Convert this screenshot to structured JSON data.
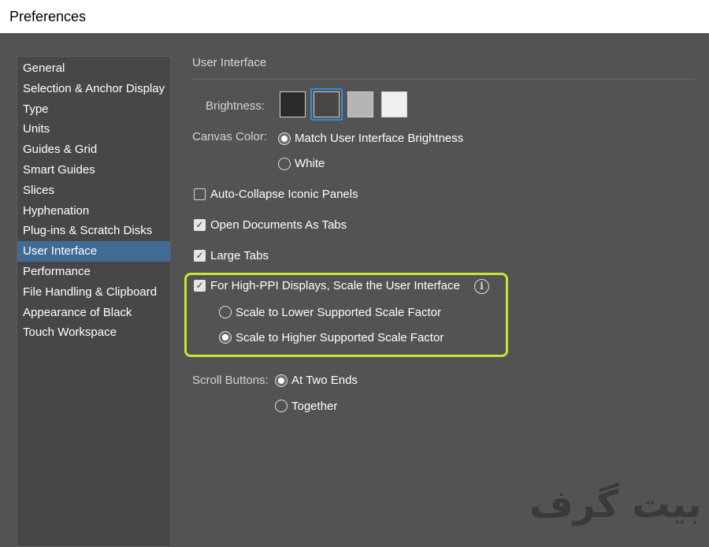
{
  "window": {
    "title": "Preferences"
  },
  "sidebar": {
    "items": [
      {
        "label": "General"
      },
      {
        "label": "Selection & Anchor Display"
      },
      {
        "label": "Type"
      },
      {
        "label": "Units"
      },
      {
        "label": "Guides & Grid"
      },
      {
        "label": "Smart Guides"
      },
      {
        "label": "Slices"
      },
      {
        "label": "Hyphenation"
      },
      {
        "label": "Plug-ins & Scratch Disks"
      },
      {
        "label": "User Interface"
      },
      {
        "label": "Performance"
      },
      {
        "label": "File Handling & Clipboard"
      },
      {
        "label": "Appearance of Black"
      },
      {
        "label": "Touch Workspace"
      }
    ],
    "active": "User Interface"
  },
  "main": {
    "section_title": "User Interface",
    "brightness": {
      "label": "Brightness:",
      "swatches": [
        "#2b2b2b",
        "#474747",
        "#b5b5b5",
        "#f0f0f0"
      ],
      "selected": 1
    },
    "canvas_color": {
      "label": "Canvas Color:",
      "options": [
        {
          "label": "Match User Interface Brightness",
          "selected": true
        },
        {
          "label": "White",
          "selected": false
        }
      ]
    },
    "auto_collapse": {
      "label": "Auto-Collapse Iconic Panels",
      "checked": false
    },
    "open_as_tabs": {
      "label": "Open Documents As Tabs",
      "checked": true
    },
    "large_tabs": {
      "label": "Large Tabs",
      "checked": true
    },
    "high_ppi": {
      "label": "For High-PPI Displays, Scale the User Interface",
      "checked": true,
      "options": [
        {
          "label": "Scale to Lower Supported Scale Factor",
          "selected": false
        },
        {
          "label": "Scale to Higher Supported Scale Factor",
          "selected": true
        }
      ],
      "info_icon": "i"
    },
    "scroll_buttons": {
      "label": "Scroll Buttons:",
      "options": [
        {
          "label": "At Two Ends",
          "selected": true
        },
        {
          "label": "Together",
          "selected": false
        }
      ]
    }
  },
  "watermark": {
    "text": "بیت گرف"
  },
  "colors": {
    "accent": "#2e8ae6",
    "highlight": "#c8e630",
    "active_item": "#3f6b95"
  }
}
